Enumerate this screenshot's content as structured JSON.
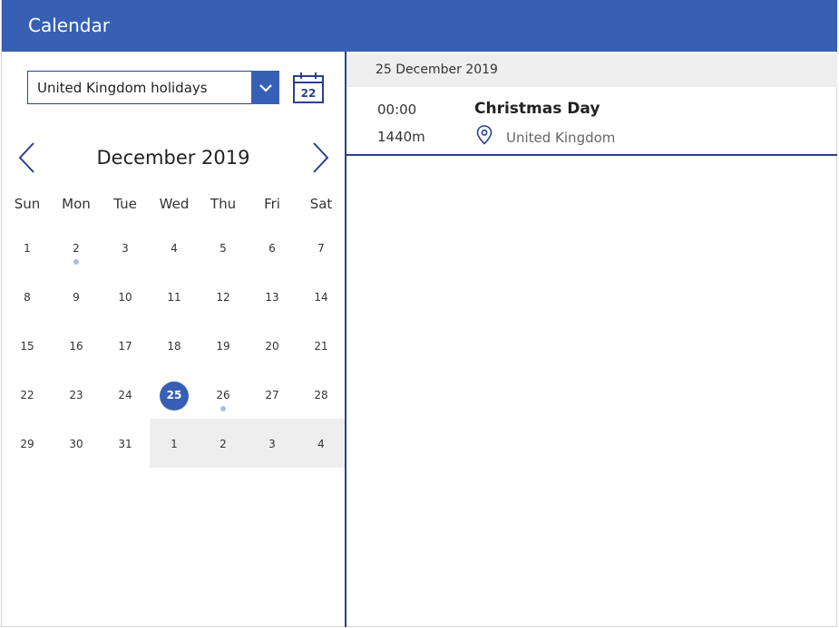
{
  "header": {
    "title": "Calendar"
  },
  "calendar_select": {
    "value": "United Kingdom holidays"
  },
  "today_icon": {
    "day": "22"
  },
  "month_label": "December 2019",
  "weekdays": [
    "Sun",
    "Mon",
    "Tue",
    "Wed",
    "Thu",
    "Fri",
    "Sat"
  ],
  "weeks": [
    [
      {
        "d": "1"
      },
      {
        "d": "2",
        "dot": true
      },
      {
        "d": "3"
      },
      {
        "d": "4"
      },
      {
        "d": "5"
      },
      {
        "d": "6"
      },
      {
        "d": "7"
      }
    ],
    [
      {
        "d": "8"
      },
      {
        "d": "9"
      },
      {
        "d": "10"
      },
      {
        "d": "11"
      },
      {
        "d": "12"
      },
      {
        "d": "13"
      },
      {
        "d": "14"
      }
    ],
    [
      {
        "d": "15"
      },
      {
        "d": "16"
      },
      {
        "d": "17"
      },
      {
        "d": "18"
      },
      {
        "d": "19"
      },
      {
        "d": "20"
      },
      {
        "d": "21"
      }
    ],
    [
      {
        "d": "22"
      },
      {
        "d": "23"
      },
      {
        "d": "24"
      },
      {
        "d": "25",
        "selected": true
      },
      {
        "d": "26",
        "dot": true
      },
      {
        "d": "27"
      },
      {
        "d": "28"
      }
    ],
    [
      {
        "d": "29"
      },
      {
        "d": "30"
      },
      {
        "d": "31"
      },
      {
        "d": "1",
        "other": true
      },
      {
        "d": "2",
        "other": true
      },
      {
        "d": "3",
        "other": true
      },
      {
        "d": "4",
        "other": true
      }
    ]
  ],
  "selected_date_label": "25 December 2019",
  "events": [
    {
      "time": "00:00",
      "duration": "1440m",
      "title": "Christmas Day",
      "location": "United Kingdom"
    }
  ],
  "colors": {
    "accent": "#3760b5",
    "border": "#2b3f8f",
    "dot": "#a9bde2",
    "muted_bg": "#eeeeee"
  },
  "icons": {
    "dropdown": "chevron-down-icon",
    "today": "calendar-icon",
    "prev": "chevron-left-icon",
    "next": "chevron-right-icon",
    "location": "location-pin-icon"
  }
}
